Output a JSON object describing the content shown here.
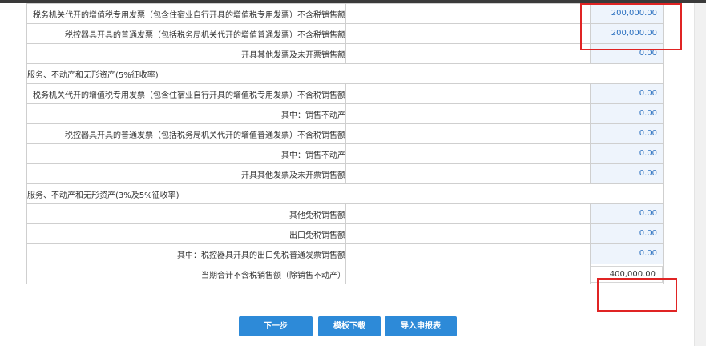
{
  "rows": [
    {
      "type": "item",
      "label": "税务机关代开的增值税专用发票（包含住宿业自行开具的增值税专用发票）不含税销售额",
      "value": "200,000.00"
    },
    {
      "type": "item",
      "label": "税控器具开具的普通发票（包括税务局机关代开的增值普通发票）不含税销售额",
      "value": "200,000.00"
    },
    {
      "type": "item",
      "label": "开具其他发票及未开票销售额",
      "value": "0.00"
    },
    {
      "type": "section",
      "label": "服务、不动产和无形资产(5%征收率)"
    },
    {
      "type": "item",
      "label": "税务机关代开的增值税专用发票（包含住宿业自行开具的增值税专用发票）不含税销售额",
      "value": "0.00"
    },
    {
      "type": "item",
      "label": "其中：销售不动产",
      "value": "0.00"
    },
    {
      "type": "item",
      "label": "税控器具开具的普通发票（包括税务局机关代开的增值普通发票）不含税销售额",
      "value": "0.00"
    },
    {
      "type": "item",
      "label": "其中：销售不动产",
      "value": "0.00"
    },
    {
      "type": "item",
      "label": "开具其他发票及未开票销售额",
      "value": "0.00"
    },
    {
      "type": "section",
      "label": "服务、不动产和无形资产(3%及5%征收率)"
    },
    {
      "type": "item",
      "label": "其他免税销售额",
      "value": "0.00"
    },
    {
      "type": "item",
      "label": "出口免税销售额",
      "value": "0.00"
    },
    {
      "type": "item",
      "label": "其中：税控器具开具的出口免税普通发票销售额",
      "value": "0.00"
    },
    {
      "type": "total",
      "label": "当期合计不含税销售额（除销售不动产）",
      "value": "400,000.00"
    }
  ],
  "buttons": {
    "next": "下一步",
    "template_download": "模板下载",
    "import_report": "导入申报表"
  },
  "colors": {
    "accent": "#2d8ad8",
    "highlight_box": "#e02424",
    "value_text": "#2a6fbf",
    "value_bg": "#eef4fc"
  }
}
